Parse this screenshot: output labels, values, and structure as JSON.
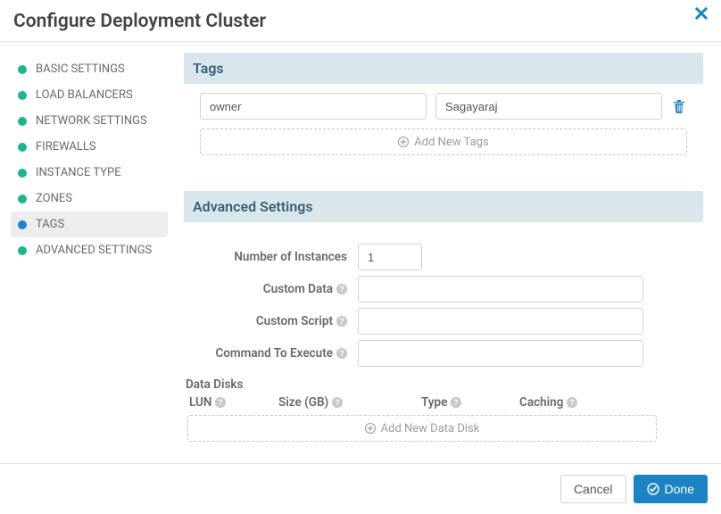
{
  "header": {
    "title": "Configure Deployment Cluster"
  },
  "sidebar": {
    "items": [
      {
        "label": "BASIC SETTINGS",
        "status": "green",
        "active": false
      },
      {
        "label": "LOAD BALANCERS",
        "status": "green",
        "active": false
      },
      {
        "label": "NETWORK SETTINGS",
        "status": "green",
        "active": false
      },
      {
        "label": "FIREWALLS",
        "status": "green",
        "active": false
      },
      {
        "label": "INSTANCE TYPE",
        "status": "green",
        "active": false
      },
      {
        "label": "ZONES",
        "status": "green",
        "active": false
      },
      {
        "label": "TAGS",
        "status": "blue",
        "active": true
      },
      {
        "label": "ADVANCED SETTINGS",
        "status": "green",
        "active": false
      }
    ]
  },
  "tags": {
    "title": "Tags",
    "rows": [
      {
        "key": "owner",
        "value": "Sagayaraj"
      }
    ],
    "add_label": "Add New Tags"
  },
  "advanced": {
    "title": "Advanced Settings",
    "num_instances_label": "Number of Instances",
    "num_instances_value": "1",
    "custom_data_label": "Custom Data",
    "custom_data_value": "",
    "custom_script_label": "Custom Script",
    "custom_script_value": "",
    "command_label": "Command To Execute",
    "command_value": "",
    "data_disks": {
      "heading": "Data Disks",
      "cols": {
        "lun": "LUN",
        "size": "Size (GB)",
        "type": "Type",
        "caching": "Caching"
      },
      "add_label": "Add New Data Disk"
    }
  },
  "footer": {
    "cancel_label": "Cancel",
    "done_label": "Done"
  }
}
